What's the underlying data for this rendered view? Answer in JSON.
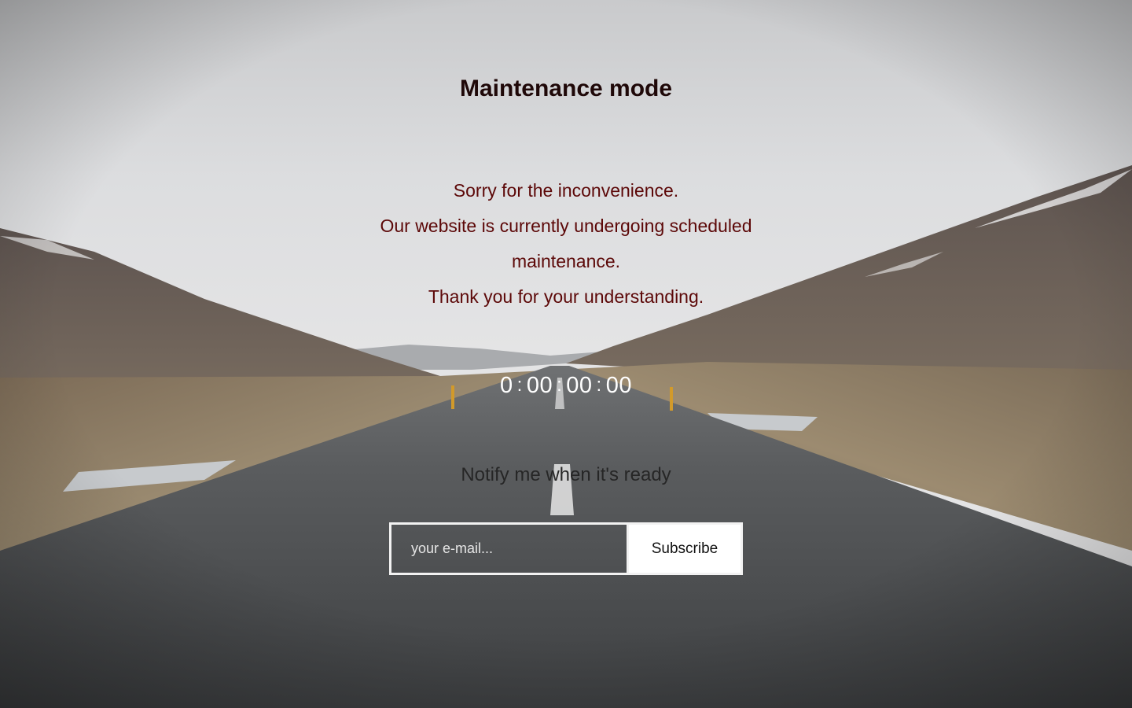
{
  "page": {
    "title": "Maintenance mode",
    "message_lines": [
      "Sorry for the inconvenience.",
      "Our website is currently undergoing scheduled maintenance.",
      "Thank you for your understanding."
    ]
  },
  "countdown": {
    "days": "0",
    "hours": "00",
    "minutes": "00",
    "seconds": "00",
    "separator": ":"
  },
  "subscribe": {
    "heading": "Notify me when it's ready",
    "email_placeholder": "your e-mail...",
    "button_label": "Subscribe"
  },
  "colors": {
    "title": "#1f0808",
    "message": "#5c0808",
    "countdown": "#ffffff",
    "notify": "#262626",
    "form_border": "#f2f2f2",
    "button_bg": "#ffffff"
  },
  "background": {
    "description_icon": "mountain-road-photo"
  }
}
